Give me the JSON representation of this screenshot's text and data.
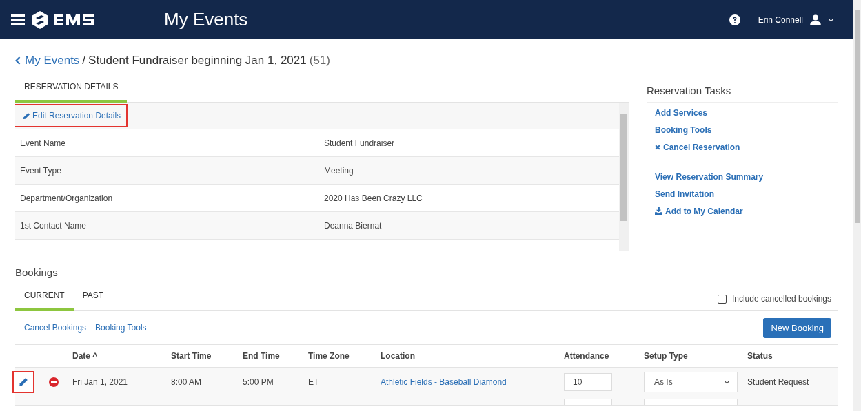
{
  "header": {
    "title": "My Events",
    "user": "Erin Connell"
  },
  "breadcrumb": {
    "back": "My Events",
    "separator": "/",
    "current": "Student Fundraiser beginning Jan 1, 2021",
    "count": "(51)"
  },
  "detail_tabs": [
    {
      "label": "RESERVATION DETAILS",
      "selected": true
    }
  ],
  "edit_link": "Edit Reservation Details",
  "details": [
    {
      "label": "Event Name",
      "value": "Student Fundraiser"
    },
    {
      "label": "Event Type",
      "value": "Meeting"
    },
    {
      "label": "Department/Organization",
      "value": "2020 Has Been Crazy LLC"
    },
    {
      "label": "1st Contact Name",
      "value": "Deanna Biernat"
    }
  ],
  "tasks": {
    "title": "Reservation Tasks",
    "groups": [
      [
        {
          "label": "Add Services",
          "kind": "plain"
        },
        {
          "label": "Booking Tools",
          "kind": "plain"
        },
        {
          "label": "Cancel Reservation",
          "kind": "cancel"
        }
      ],
      [
        {
          "label": "View Reservation Summary",
          "kind": "plain"
        },
        {
          "label": "Send Invitation",
          "kind": "plain"
        },
        {
          "label": "Add to My Calendar",
          "kind": "download"
        }
      ]
    ]
  },
  "bookings": {
    "title": "Bookings",
    "tabs": [
      {
        "label": "CURRENT",
        "selected": true
      },
      {
        "label": "PAST",
        "selected": false
      }
    ],
    "include_cancelled": {
      "label": "Include cancelled bookings",
      "checked": false
    },
    "links": [
      "Cancel Bookings",
      "Booking Tools"
    ],
    "new_button": "New Booking",
    "columns": [
      "Date ^",
      "Start Time",
      "End Time",
      "Time Zone",
      "Location",
      "Attendance",
      "Setup Type",
      "Status"
    ],
    "rows": [
      {
        "date": "Fri Jan 1, 2021",
        "start": "8:00 AM",
        "end": "5:00 PM",
        "zone": "ET",
        "location": "Athletic Fields - Baseball Diamond",
        "attendance": "10",
        "setup": "As Is",
        "status": "Student Request"
      }
    ]
  }
}
